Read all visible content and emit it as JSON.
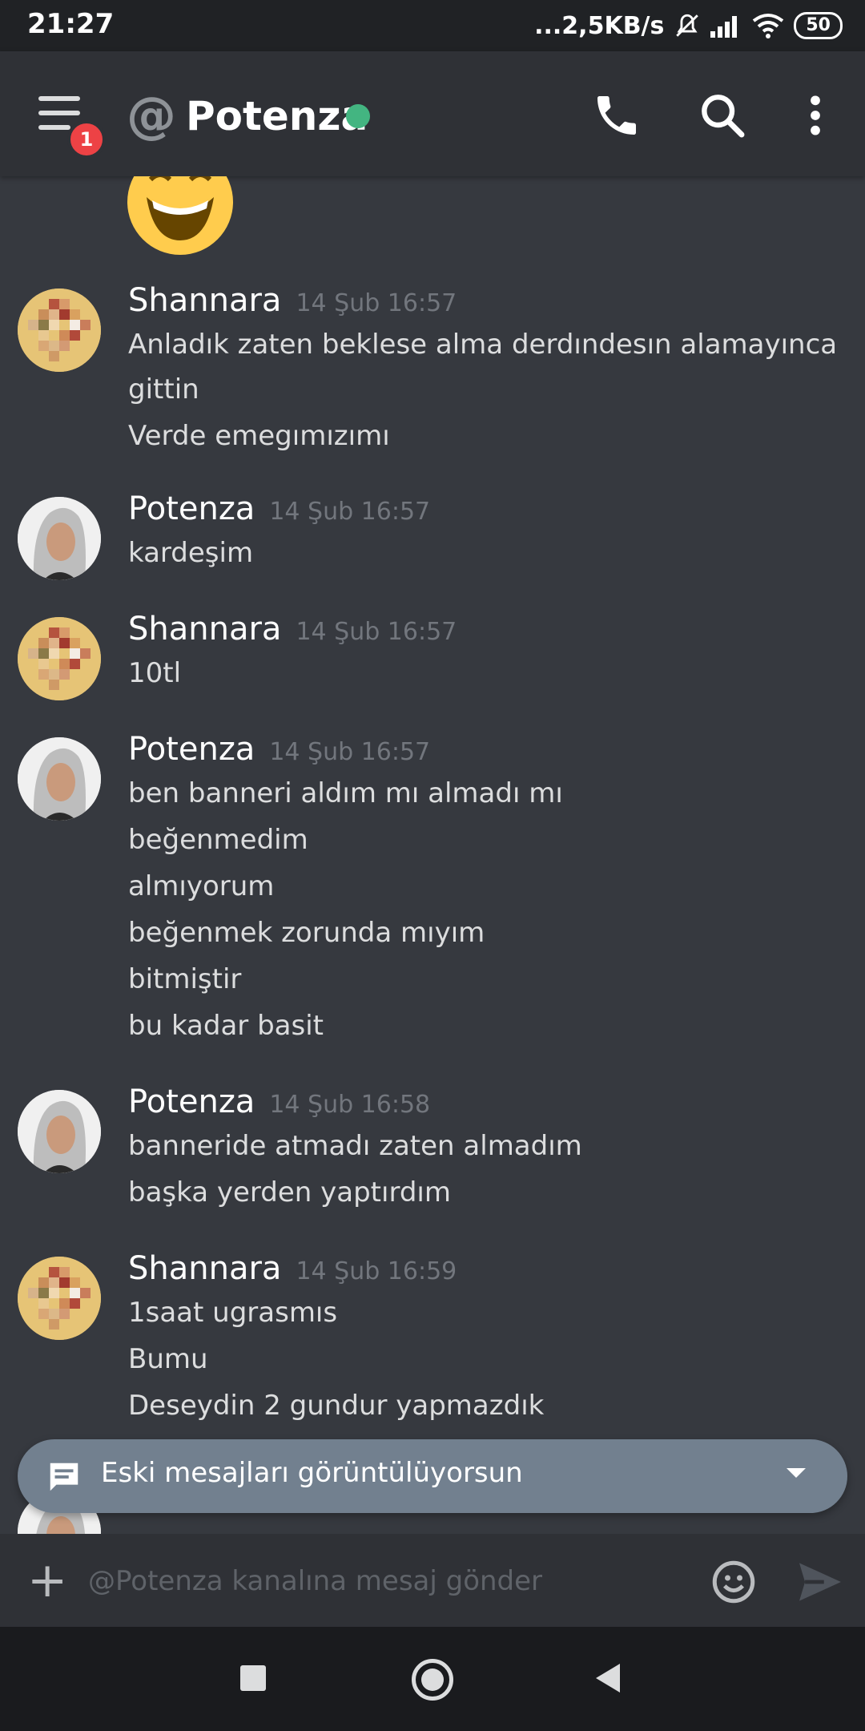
{
  "status_bar": {
    "time": "21:27",
    "network_speed": "...2,5KB/s",
    "battery": "50"
  },
  "header": {
    "channel_name": "Potenza",
    "notification_count": "1",
    "online_color": "#43b581"
  },
  "messages": [
    {
      "author": "Shannara",
      "time": "14 Şub 16:57",
      "avatar": "pixel-avatar",
      "lines": [
        "Anladık zaten beklese alma derdındesın alamayınca",
        "gittin",
        "Verde emegımızımı"
      ]
    },
    {
      "author": "Potenza",
      "time": "14 Şub 16:57",
      "avatar": "photo-avatar",
      "lines": [
        "kardeşim"
      ]
    },
    {
      "author": "Shannara",
      "time": "14 Şub 16:57",
      "avatar": "pixel-avatar",
      "lines": [
        "10tl"
      ]
    },
    {
      "author": "Potenza",
      "time": "14 Şub 16:57",
      "avatar": "photo-avatar",
      "lines": [
        "ben banneri aldım mı almadı mı",
        "beğenmedim",
        "almıyorum",
        "beğenmek zorunda mıyım",
        "bitmiştir",
        "bu kadar basit"
      ]
    },
    {
      "author": "Potenza",
      "time": "14 Şub 16:58",
      "avatar": "photo-avatar",
      "lines": [
        "banneride atmadı zaten almadım",
        "başka yerden yaptırdım"
      ]
    },
    {
      "author": "Shannara",
      "time": "14 Şub 16:59",
      "avatar": "pixel-avatar",
      "lines": [
        "1saat ugrasmıs",
        "Bumu",
        "Deseydin 2 gundur yapmazdık"
      ]
    }
  ],
  "old_messages_banner": {
    "text": "Eski mesajları görüntülüyorsun"
  },
  "composer": {
    "placeholder": "@Potenza kanalına mesaj gönder"
  },
  "icons": {
    "menu": "hamburger-menu-icon",
    "call": "phone-icon",
    "search": "search-icon",
    "more": "more-vertical-icon",
    "emoji": "smiley-icon",
    "send": "send-icon",
    "attach": "plus-icon",
    "banner": "chat-bubble-icon"
  }
}
